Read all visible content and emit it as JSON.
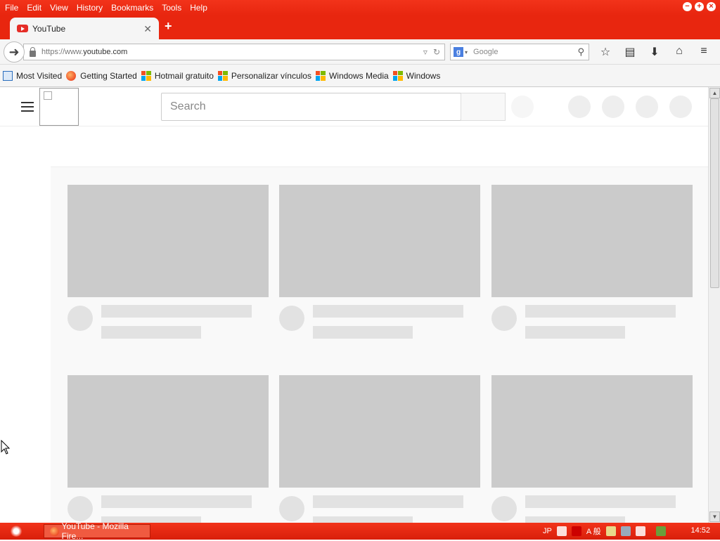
{
  "menubar": {
    "items": [
      "File",
      "Edit",
      "View",
      "History",
      "Bookmarks",
      "Tools",
      "Help"
    ]
  },
  "tab": {
    "title": "YouTube"
  },
  "navbar": {
    "url_prefix": "https://www.",
    "url_domain": "youtube.com",
    "search_engine_placeholder": "Google"
  },
  "bookmarks": [
    {
      "label": "Most Visited",
      "icon": "most-visited-icon"
    },
    {
      "label": "Getting Started",
      "icon": "firefox-icon"
    },
    {
      "label": "Hotmail gratuito",
      "icon": "windows-logo-icon"
    },
    {
      "label": "Personalizar vínculos",
      "icon": "windows-logo-icon"
    },
    {
      "label": "Windows Media",
      "icon": "windows-logo-icon"
    },
    {
      "label": "Windows",
      "icon": "windows-logo-icon"
    }
  ],
  "youtube": {
    "search_placeholder": "Search"
  },
  "taskbar": {
    "task_label": "YouTube - Mozilla Fire...",
    "tray_lang": "JP",
    "tray_ime": "A 般",
    "clock": "14:52"
  },
  "colors": {
    "accent": "#e8260f",
    "skeleton": "#cbcbcb",
    "skeleton_light": "#e2e2e2"
  }
}
